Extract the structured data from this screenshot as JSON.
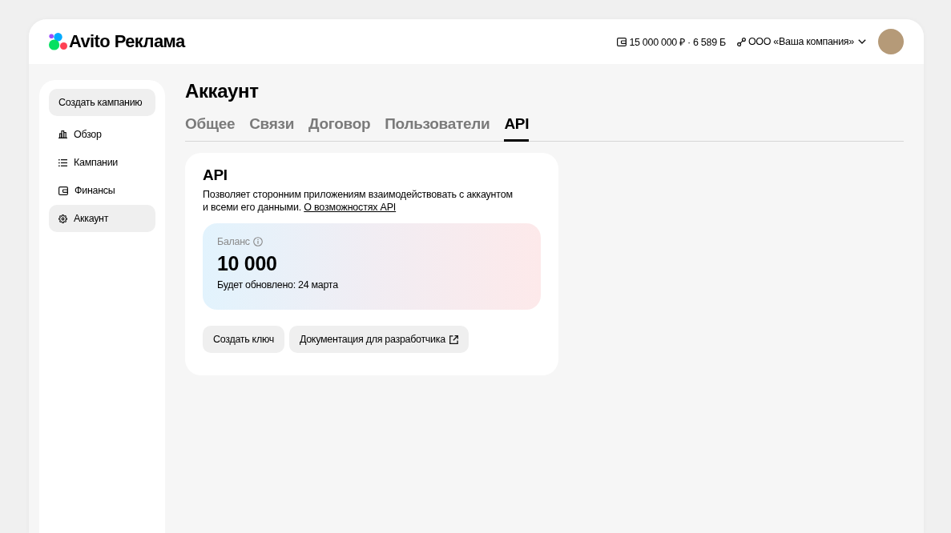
{
  "header": {
    "logo": "Avito Реклама",
    "balance": "15 000 000 ₽ · 6 589 Б",
    "company": "ООО «Ваша компания»"
  },
  "sidebar": {
    "create_button": "Создать кампанию",
    "items": [
      {
        "label": "Обзор",
        "kind": "overview",
        "selected": false
      },
      {
        "label": "Кампании",
        "kind": "campaigns",
        "selected": false
      },
      {
        "label": "Финансы",
        "kind": "finance",
        "selected": false
      },
      {
        "label": "Аккаунт",
        "kind": "account",
        "selected": true
      }
    ]
  },
  "page": {
    "title": "Аккаунт",
    "tabs": [
      {
        "label": "Общее",
        "selected": false
      },
      {
        "label": "Связи",
        "selected": false
      },
      {
        "label": "Договор",
        "selected": false
      },
      {
        "label": "Пользователи",
        "selected": false
      },
      {
        "label": "API",
        "selected": true
      }
    ]
  },
  "api_card": {
    "title": "API",
    "description": "Позволяет сторонним приложениям взаимодействовать с аккаунтом и всеми его данными.",
    "link": "О возможностях API",
    "balance": {
      "label": "Баланс",
      "value": "10 000",
      "note": "Будет обновлено: 24 марта"
    },
    "buttons": [
      {
        "label": "Создать ключ",
        "kind": "create"
      },
      {
        "label": "Документация для разработчика",
        "kind": "external"
      }
    ]
  }
}
